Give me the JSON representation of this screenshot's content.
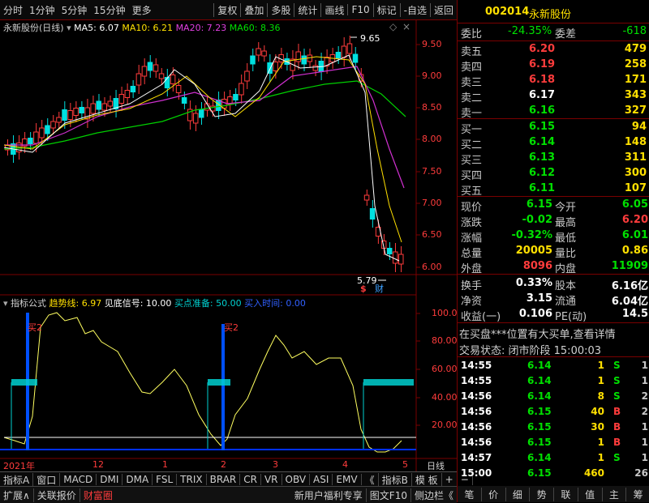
{
  "toolbar": {
    "tabs": [
      "分时",
      "1分钟",
      "5分钟",
      "15分钟",
      "更多"
    ],
    "buttons": [
      "复权",
      "叠加",
      "多股",
      "统计",
      "画线",
      "F10",
      "标记",
      "-自选",
      "返回"
    ]
  },
  "chart_header": {
    "name": "永新股份(日线)",
    "ma5": "MA5: 6.07",
    "ma10": "MA10: 6.21",
    "ma20": "MA20: 7.23",
    "ma60": "MA60: 8.36"
  },
  "main_axis": [
    "9.50",
    "9.00",
    "8.50",
    "8.00",
    "7.50",
    "7.00",
    "6.50",
    "6.00"
  ],
  "annotations": {
    "high": "9.65",
    "low": "5.79",
    "badge_s": "$",
    "badge_c": "财"
  },
  "indicator_header": {
    "label": "指标公式",
    "trend": "趋势线: 6.97",
    "bottom": "见底信号: 10.00",
    "buy_ready": "买点准备: 50.00",
    "buy_time": "买入时间: 0.00"
  },
  "ind_axis": [
    "100.0",
    "80.00",
    "60.00",
    "40.00",
    "20.00"
  ],
  "buy_labels": [
    "买2",
    "买2"
  ],
  "time_axis": [
    "2021年",
    "12",
    "1",
    "2",
    "3",
    "4",
    "5"
  ],
  "period": "日线",
  "bottom_tabs": [
    "指标A",
    "窗口",
    "MACD",
    "DMI",
    "DMA",
    "FSL",
    "TRIX",
    "BRAR",
    "CR",
    "VR",
    "OBV",
    "ASI",
    "EMV",
    "《",
    "指标B",
    "模 板",
    "+",
    "−"
  ],
  "bottom_bar2": [
    "扩展∧",
    "关联报价",
    "财富圈"
  ],
  "bottom_bar2_right": [
    "新用户福利专享",
    "图文F10",
    "侧边栏《"
  ],
  "quote": {
    "code": "002014",
    "name": "永新股份",
    "weibi_label": "委比",
    "weibi": "-24.35%",
    "weicha_label": "委差",
    "weicha": "-618",
    "sells": [
      [
        "卖五",
        "6.20",
        "479"
      ],
      [
        "卖四",
        "6.19",
        "258"
      ],
      [
        "卖三",
        "6.18",
        "171"
      ],
      [
        "卖二",
        "6.17",
        "343"
      ],
      [
        "卖一",
        "6.16",
        "327"
      ]
    ],
    "buys": [
      [
        "买一",
        "6.15",
        "94"
      ],
      [
        "买二",
        "6.14",
        "148"
      ],
      [
        "买三",
        "6.13",
        "311"
      ],
      [
        "买四",
        "6.12",
        "300"
      ],
      [
        "买五",
        "6.11",
        "107"
      ]
    ],
    "stats": [
      [
        "现价",
        "6.15",
        "今开",
        "6.05"
      ],
      [
        "涨跌",
        "-0.02",
        "最高",
        "6.20"
      ],
      [
        "涨幅",
        "-0.32%",
        "最低",
        "6.01"
      ],
      [
        "总量",
        "20005",
        "量比",
        "0.86"
      ],
      [
        "外盘",
        "8096",
        "内盘",
        "11909"
      ]
    ],
    "stats2": [
      [
        "换手",
        "0.33%",
        "股本",
        "6.16亿"
      ],
      [
        "净资",
        "3.15",
        "流通",
        "6.04亿"
      ],
      [
        "收益(一)",
        "0.106",
        "PE(动)",
        "14.5"
      ]
    ],
    "notice": "在买盘***位置有大买单,查看详情",
    "status": "交易状态: 闭市阶段  15:00:03",
    "ticks": [
      [
        "14:55",
        "6.14",
        "1",
        "S",
        "1"
      ],
      [
        "14:55",
        "6.14",
        "1",
        "S",
        "1"
      ],
      [
        "14:56",
        "6.14",
        "8",
        "S",
        "2"
      ],
      [
        "14:56",
        "6.15",
        "40",
        "B",
        "2"
      ],
      [
        "14:56",
        "6.15",
        "30",
        "B",
        "1"
      ],
      [
        "14:56",
        "6.15",
        "1",
        "B",
        "1"
      ],
      [
        "14:57",
        "6.14",
        "1",
        "S",
        "1"
      ],
      [
        "15:00",
        "6.15",
        "460",
        "",
        "26"
      ]
    ],
    "nav": [
      "笔",
      "价",
      "细",
      "势",
      "联",
      "值",
      "主",
      "筹"
    ]
  }
}
